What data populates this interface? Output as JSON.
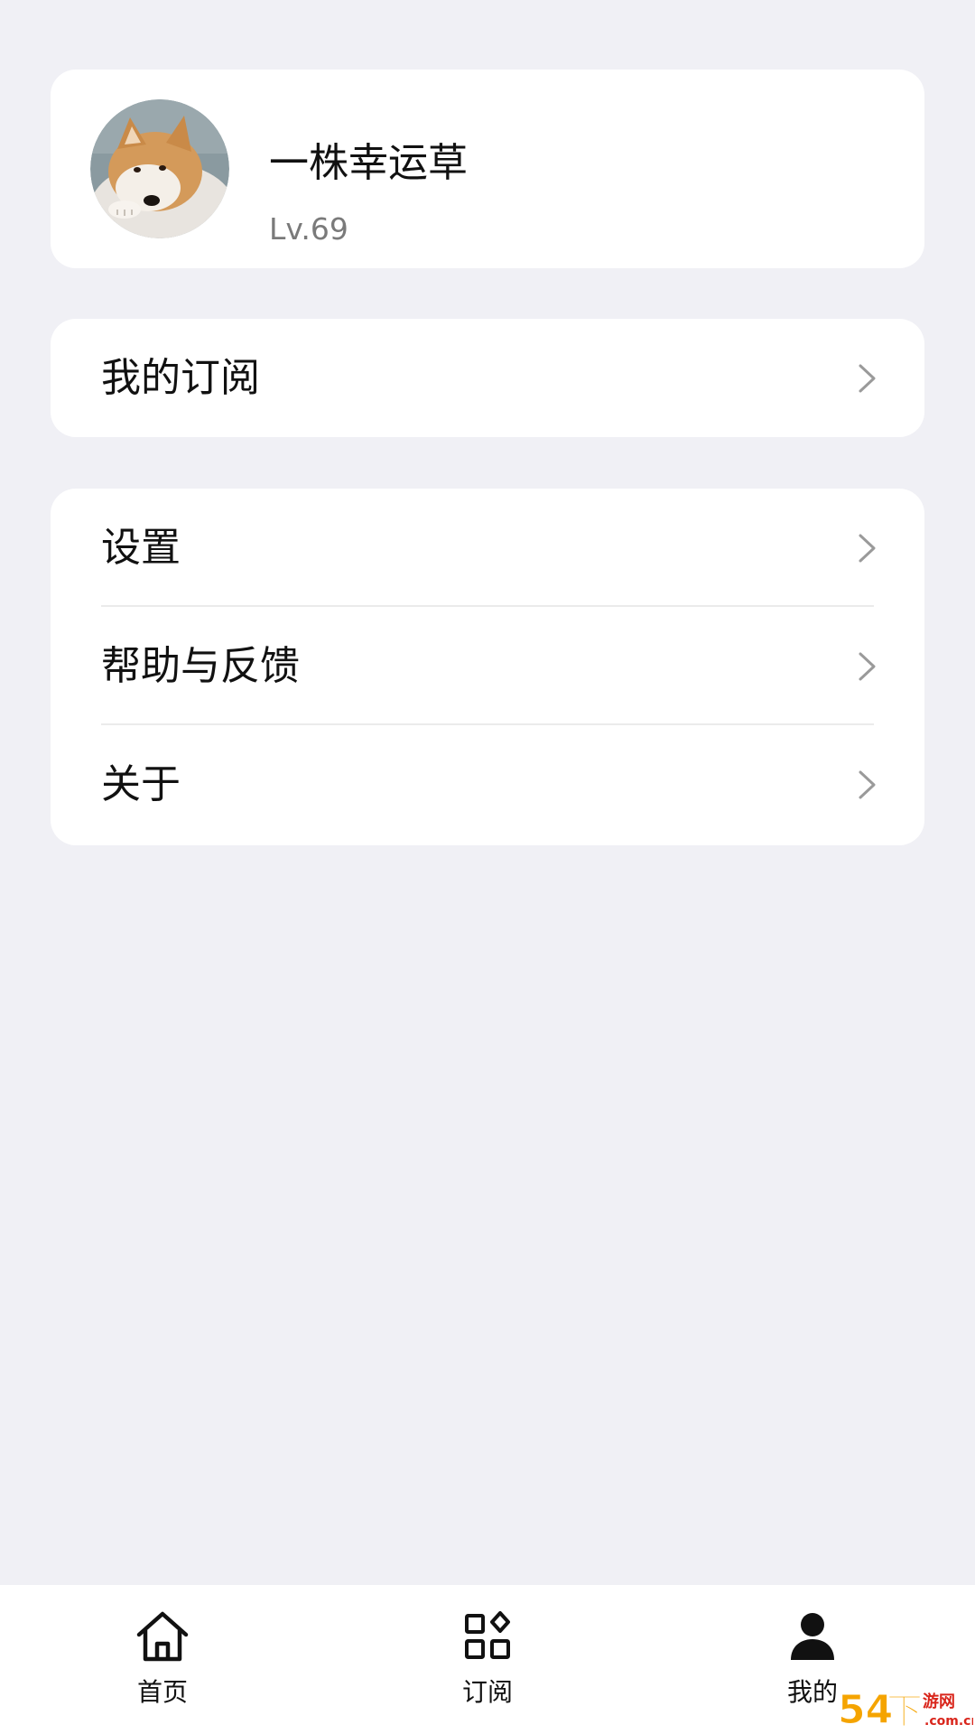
{
  "profile": {
    "username": "一株幸运草",
    "level": "Lv.69",
    "avatar_icon": "shiba-dog-avatar"
  },
  "menu_group_1": {
    "items": [
      {
        "label": "我的订阅",
        "icon": "chevron-right-icon"
      }
    ]
  },
  "menu_group_2": {
    "items": [
      {
        "label": "设置",
        "icon": "chevron-right-icon"
      },
      {
        "label": "帮助与反馈",
        "icon": "chevron-right-icon"
      },
      {
        "label": "关于",
        "icon": "chevron-right-icon"
      }
    ]
  },
  "bottom_nav": {
    "items": [
      {
        "label": "首页",
        "icon": "home-icon",
        "active": false
      },
      {
        "label": "订阅",
        "icon": "apps-icon",
        "active": false
      },
      {
        "label": "我的",
        "icon": "person-icon",
        "active": true
      }
    ]
  },
  "watermark": {
    "text": "54下游网",
    "domain": ".com.cn"
  },
  "colors": {
    "background": "#f0f0f5",
    "card": "#ffffff",
    "text_primary": "#111111",
    "text_secondary": "#7a7a7a",
    "chevron": "#9a9a9a",
    "watermark_orange": "#f5a400",
    "watermark_red": "#d9261c"
  }
}
